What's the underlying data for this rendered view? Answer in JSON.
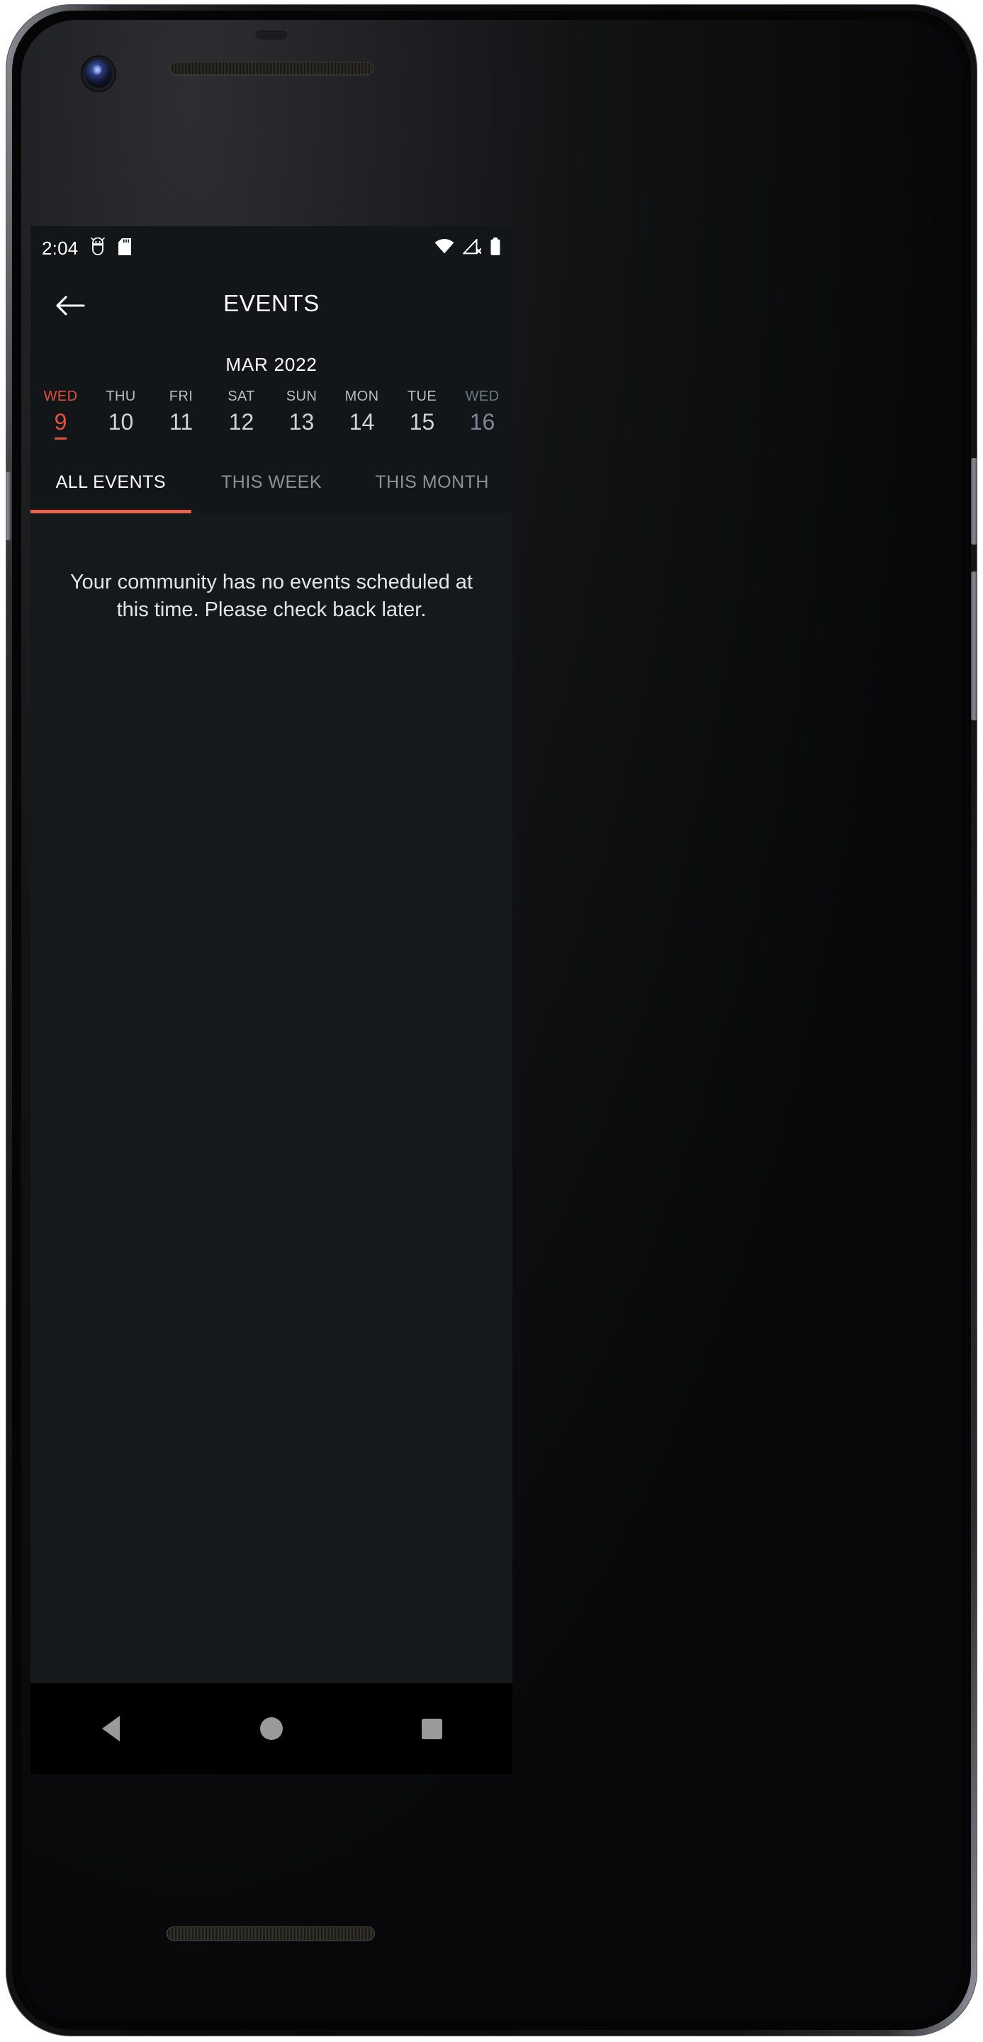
{
  "status_bar": {
    "clock": "2:04",
    "left_icons": [
      "android-debug-icon",
      "sd-card-icon"
    ],
    "right_icons": [
      "wifi-icon",
      "cellular-no-signal-icon",
      "battery-full-icon"
    ]
  },
  "app_bar": {
    "back_icon": "arrow-left-icon",
    "title": "EVENTS"
  },
  "calendar": {
    "month_label": "MAR 2022",
    "days": [
      {
        "dow": "WED",
        "num": "9",
        "state": "selected"
      },
      {
        "dow": "THU",
        "num": "10",
        "state": "normal"
      },
      {
        "dow": "FRI",
        "num": "11",
        "state": "normal"
      },
      {
        "dow": "SAT",
        "num": "12",
        "state": "normal"
      },
      {
        "dow": "SUN",
        "num": "13",
        "state": "normal"
      },
      {
        "dow": "MON",
        "num": "14",
        "state": "normal"
      },
      {
        "dow": "TUE",
        "num": "15",
        "state": "normal"
      },
      {
        "dow": "WED",
        "num": "16",
        "state": "dim"
      }
    ]
  },
  "tabs": [
    {
      "label": "ALL EVENTS",
      "active": true
    },
    {
      "label": "THIS WEEK",
      "active": false
    },
    {
      "label": "THIS MONTH",
      "active": false
    }
  ],
  "content": {
    "empty_state_message": "Your community has no events scheduled at this time. Please check back later."
  },
  "nav_bar": {
    "back_label": "back-triangle-icon",
    "home_label": "home-circle-icon",
    "recents_label": "recents-square-icon"
  },
  "colors": {
    "accent": "#e8614a",
    "selected_day": "#e0533c",
    "screen_bg": "#131619",
    "content_bg": "#16191c",
    "text_primary": "#ffffff",
    "text_secondary": "#8d9196"
  }
}
